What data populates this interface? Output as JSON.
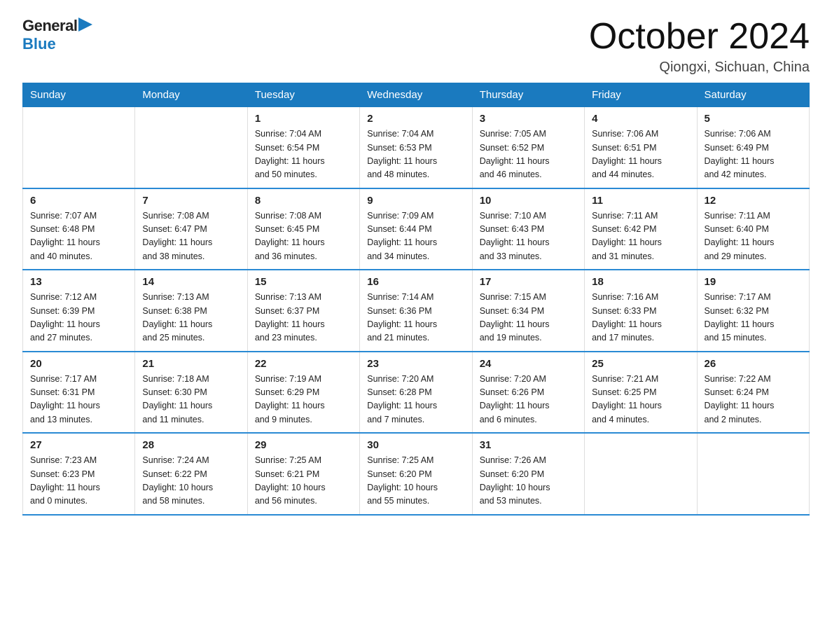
{
  "logo": {
    "general": "General",
    "blue": "Blue"
  },
  "header": {
    "month": "October 2024",
    "location": "Qiongxi, Sichuan, China"
  },
  "weekdays": [
    "Sunday",
    "Monday",
    "Tuesday",
    "Wednesday",
    "Thursday",
    "Friday",
    "Saturday"
  ],
  "weeks": [
    [
      {
        "day": "",
        "info": ""
      },
      {
        "day": "",
        "info": ""
      },
      {
        "day": "1",
        "info": "Sunrise: 7:04 AM\nSunset: 6:54 PM\nDaylight: 11 hours\nand 50 minutes."
      },
      {
        "day": "2",
        "info": "Sunrise: 7:04 AM\nSunset: 6:53 PM\nDaylight: 11 hours\nand 48 minutes."
      },
      {
        "day": "3",
        "info": "Sunrise: 7:05 AM\nSunset: 6:52 PM\nDaylight: 11 hours\nand 46 minutes."
      },
      {
        "day": "4",
        "info": "Sunrise: 7:06 AM\nSunset: 6:51 PM\nDaylight: 11 hours\nand 44 minutes."
      },
      {
        "day": "5",
        "info": "Sunrise: 7:06 AM\nSunset: 6:49 PM\nDaylight: 11 hours\nand 42 minutes."
      }
    ],
    [
      {
        "day": "6",
        "info": "Sunrise: 7:07 AM\nSunset: 6:48 PM\nDaylight: 11 hours\nand 40 minutes."
      },
      {
        "day": "7",
        "info": "Sunrise: 7:08 AM\nSunset: 6:47 PM\nDaylight: 11 hours\nand 38 minutes."
      },
      {
        "day": "8",
        "info": "Sunrise: 7:08 AM\nSunset: 6:45 PM\nDaylight: 11 hours\nand 36 minutes."
      },
      {
        "day": "9",
        "info": "Sunrise: 7:09 AM\nSunset: 6:44 PM\nDaylight: 11 hours\nand 34 minutes."
      },
      {
        "day": "10",
        "info": "Sunrise: 7:10 AM\nSunset: 6:43 PM\nDaylight: 11 hours\nand 33 minutes."
      },
      {
        "day": "11",
        "info": "Sunrise: 7:11 AM\nSunset: 6:42 PM\nDaylight: 11 hours\nand 31 minutes."
      },
      {
        "day": "12",
        "info": "Sunrise: 7:11 AM\nSunset: 6:40 PM\nDaylight: 11 hours\nand 29 minutes."
      }
    ],
    [
      {
        "day": "13",
        "info": "Sunrise: 7:12 AM\nSunset: 6:39 PM\nDaylight: 11 hours\nand 27 minutes."
      },
      {
        "day": "14",
        "info": "Sunrise: 7:13 AM\nSunset: 6:38 PM\nDaylight: 11 hours\nand 25 minutes."
      },
      {
        "day": "15",
        "info": "Sunrise: 7:13 AM\nSunset: 6:37 PM\nDaylight: 11 hours\nand 23 minutes."
      },
      {
        "day": "16",
        "info": "Sunrise: 7:14 AM\nSunset: 6:36 PM\nDaylight: 11 hours\nand 21 minutes."
      },
      {
        "day": "17",
        "info": "Sunrise: 7:15 AM\nSunset: 6:34 PM\nDaylight: 11 hours\nand 19 minutes."
      },
      {
        "day": "18",
        "info": "Sunrise: 7:16 AM\nSunset: 6:33 PM\nDaylight: 11 hours\nand 17 minutes."
      },
      {
        "day": "19",
        "info": "Sunrise: 7:17 AM\nSunset: 6:32 PM\nDaylight: 11 hours\nand 15 minutes."
      }
    ],
    [
      {
        "day": "20",
        "info": "Sunrise: 7:17 AM\nSunset: 6:31 PM\nDaylight: 11 hours\nand 13 minutes."
      },
      {
        "day": "21",
        "info": "Sunrise: 7:18 AM\nSunset: 6:30 PM\nDaylight: 11 hours\nand 11 minutes."
      },
      {
        "day": "22",
        "info": "Sunrise: 7:19 AM\nSunset: 6:29 PM\nDaylight: 11 hours\nand 9 minutes."
      },
      {
        "day": "23",
        "info": "Sunrise: 7:20 AM\nSunset: 6:28 PM\nDaylight: 11 hours\nand 7 minutes."
      },
      {
        "day": "24",
        "info": "Sunrise: 7:20 AM\nSunset: 6:26 PM\nDaylight: 11 hours\nand 6 minutes."
      },
      {
        "day": "25",
        "info": "Sunrise: 7:21 AM\nSunset: 6:25 PM\nDaylight: 11 hours\nand 4 minutes."
      },
      {
        "day": "26",
        "info": "Sunrise: 7:22 AM\nSunset: 6:24 PM\nDaylight: 11 hours\nand 2 minutes."
      }
    ],
    [
      {
        "day": "27",
        "info": "Sunrise: 7:23 AM\nSunset: 6:23 PM\nDaylight: 11 hours\nand 0 minutes."
      },
      {
        "day": "28",
        "info": "Sunrise: 7:24 AM\nSunset: 6:22 PM\nDaylight: 10 hours\nand 58 minutes."
      },
      {
        "day": "29",
        "info": "Sunrise: 7:25 AM\nSunset: 6:21 PM\nDaylight: 10 hours\nand 56 minutes."
      },
      {
        "day": "30",
        "info": "Sunrise: 7:25 AM\nSunset: 6:20 PM\nDaylight: 10 hours\nand 55 minutes."
      },
      {
        "day": "31",
        "info": "Sunrise: 7:26 AM\nSunset: 6:20 PM\nDaylight: 10 hours\nand 53 minutes."
      },
      {
        "day": "",
        "info": ""
      },
      {
        "day": "",
        "info": ""
      }
    ]
  ]
}
